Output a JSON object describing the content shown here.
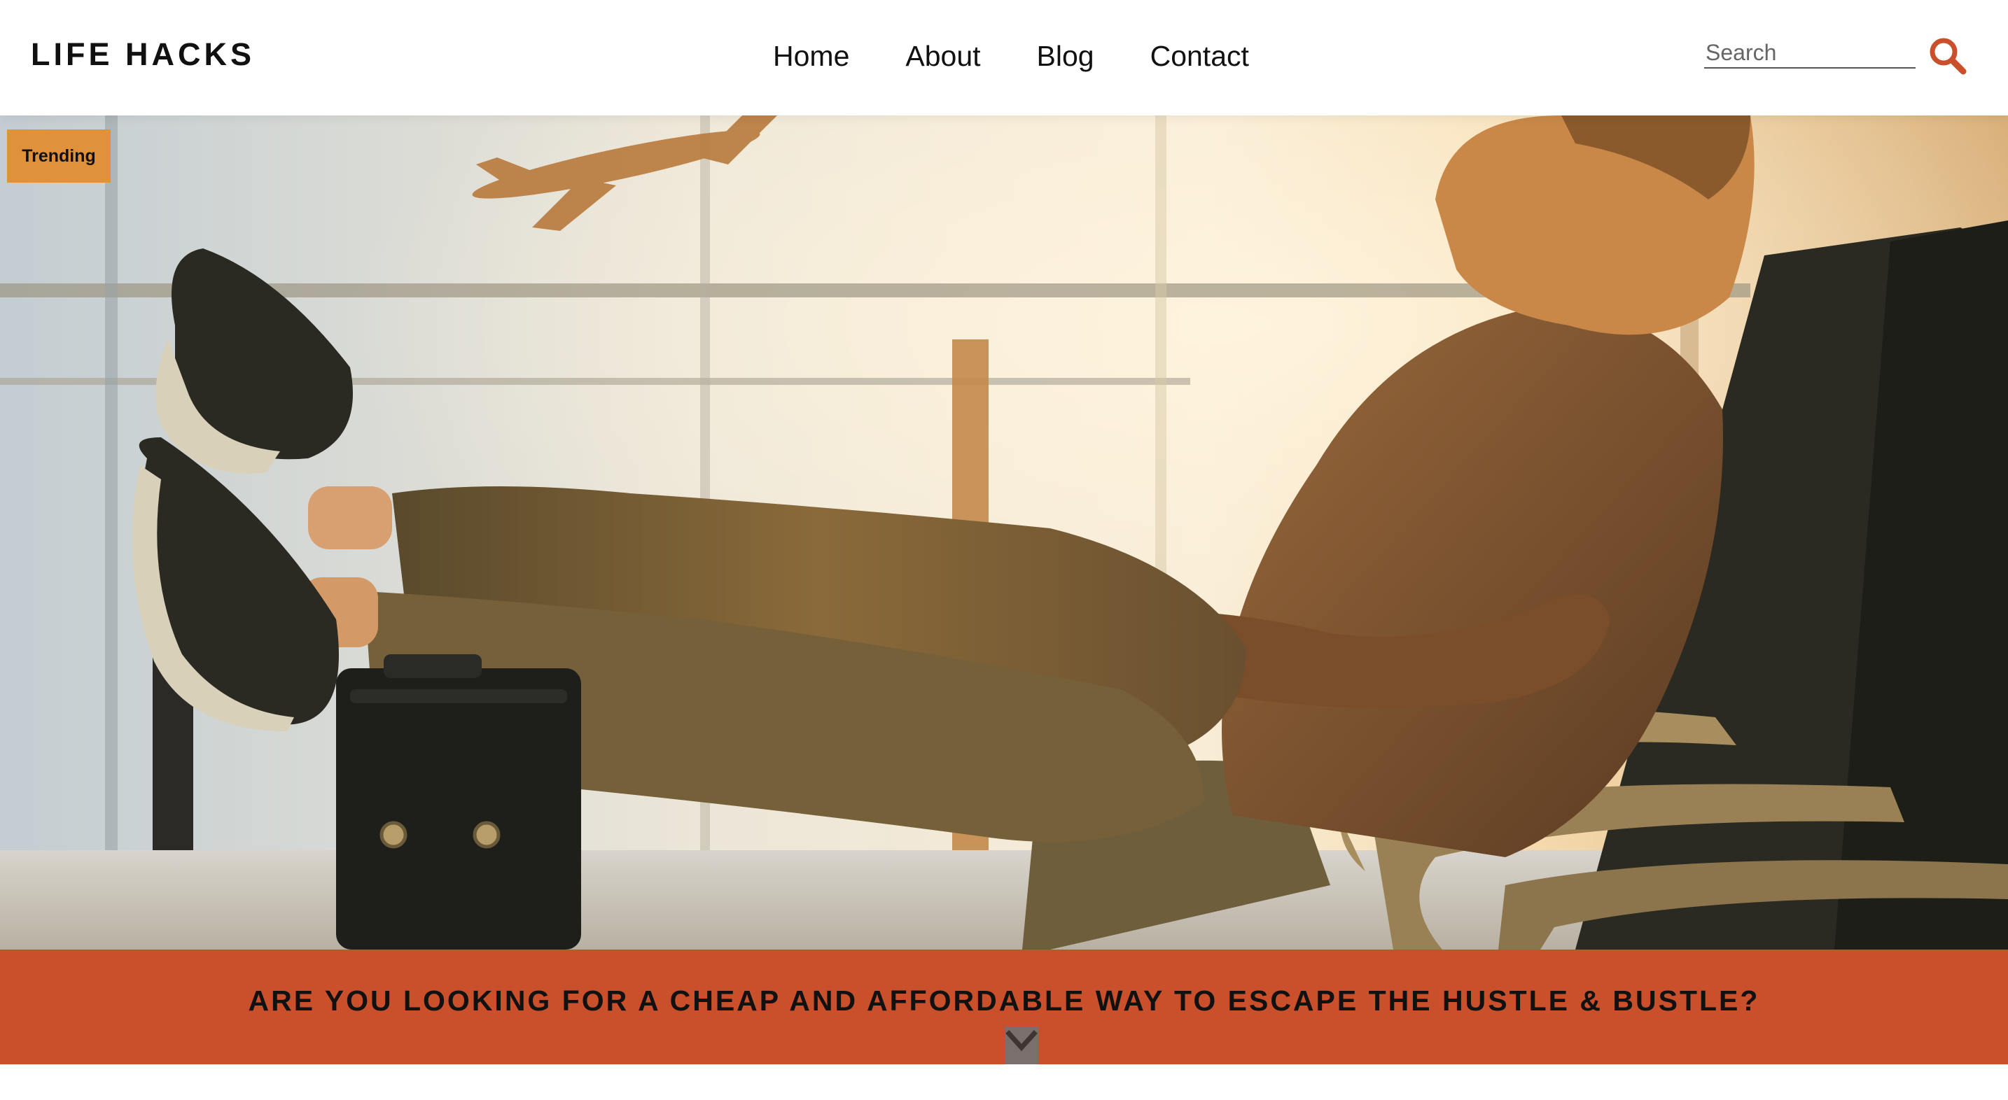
{
  "site": {
    "logo": "LIFE HACKS"
  },
  "nav": {
    "items": [
      {
        "label": "Home"
      },
      {
        "label": "About"
      },
      {
        "label": "Blog"
      },
      {
        "label": "Contact"
      }
    ]
  },
  "search": {
    "placeholder": "Search",
    "icon": "search-icon"
  },
  "hero": {
    "badge": "Trending",
    "image_description_icon": "hero-photo"
  },
  "banner": {
    "text": "ARE YOU LOOKING FOR A CHEAP AND AFFORDABLE WAY TO ESCAPE THE HUSTLE & BUSTLE?",
    "icon": "chevron-down-icon"
  },
  "colors": {
    "accent": "#c9502b",
    "badge": "#e0913c",
    "search_icon": "#c9502b",
    "chevron_bg": "#7a6f6c"
  }
}
